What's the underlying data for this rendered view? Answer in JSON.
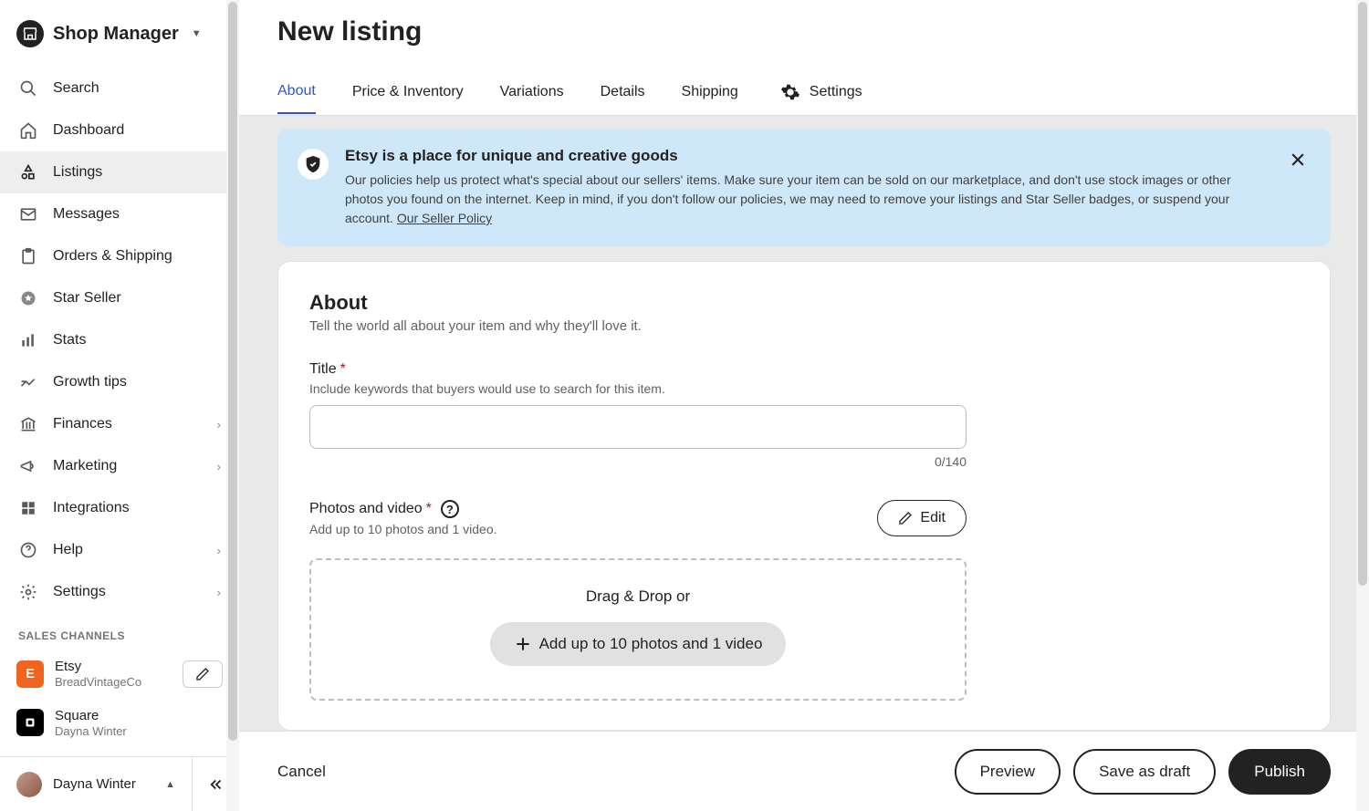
{
  "header": {
    "title": "Shop Manager"
  },
  "sidebar": {
    "items": [
      {
        "label": "Search"
      },
      {
        "label": "Dashboard"
      },
      {
        "label": "Listings"
      },
      {
        "label": "Messages"
      },
      {
        "label": "Orders & Shipping"
      },
      {
        "label": "Star Seller"
      },
      {
        "label": "Stats"
      },
      {
        "label": "Growth tips"
      },
      {
        "label": "Finances"
      },
      {
        "label": "Marketing"
      },
      {
        "label": "Integrations"
      },
      {
        "label": "Help"
      },
      {
        "label": "Settings"
      }
    ],
    "channels_label": "SALES CHANNELS",
    "channels": [
      {
        "name": "Etsy",
        "sub": "BreadVintageCo"
      },
      {
        "name": "Square",
        "sub": "Dayna Winter"
      }
    ]
  },
  "user": {
    "name": "Dayna Winter"
  },
  "page": {
    "title": "New listing",
    "tabs": [
      {
        "label": "About"
      },
      {
        "label": "Price & Inventory"
      },
      {
        "label": "Variations"
      },
      {
        "label": "Details"
      },
      {
        "label": "Shipping"
      },
      {
        "label": "Settings"
      }
    ]
  },
  "banner": {
    "title": "Etsy is a place for unique and creative goods",
    "text": "Our policies help us protect what's special about our sellers' items. Make sure your item can be sold on our marketplace, and don't use stock images or other photos you found on the internet. Keep in mind, if you don't follow our policies, we may need to remove your listings and Star Seller badges, or suspend your account. ",
    "link": "Our Seller Policy"
  },
  "about": {
    "heading": "About",
    "sub": "Tell the world all about your item and why they'll love it.",
    "title_label": "Title",
    "title_help": "Include keywords that buyers would use to search for this item.",
    "title_value": "",
    "title_counter": "0/140",
    "photos_label": "Photos and video",
    "photos_help": "Add up to 10 photos and 1 video.",
    "edit_label": "Edit",
    "dropzone_text": "Drag & Drop or",
    "dropzone_button": "Add up to 10 photos and 1 video"
  },
  "footer": {
    "cancel": "Cancel",
    "preview": "Preview",
    "draft": "Save as draft",
    "publish": "Publish"
  }
}
